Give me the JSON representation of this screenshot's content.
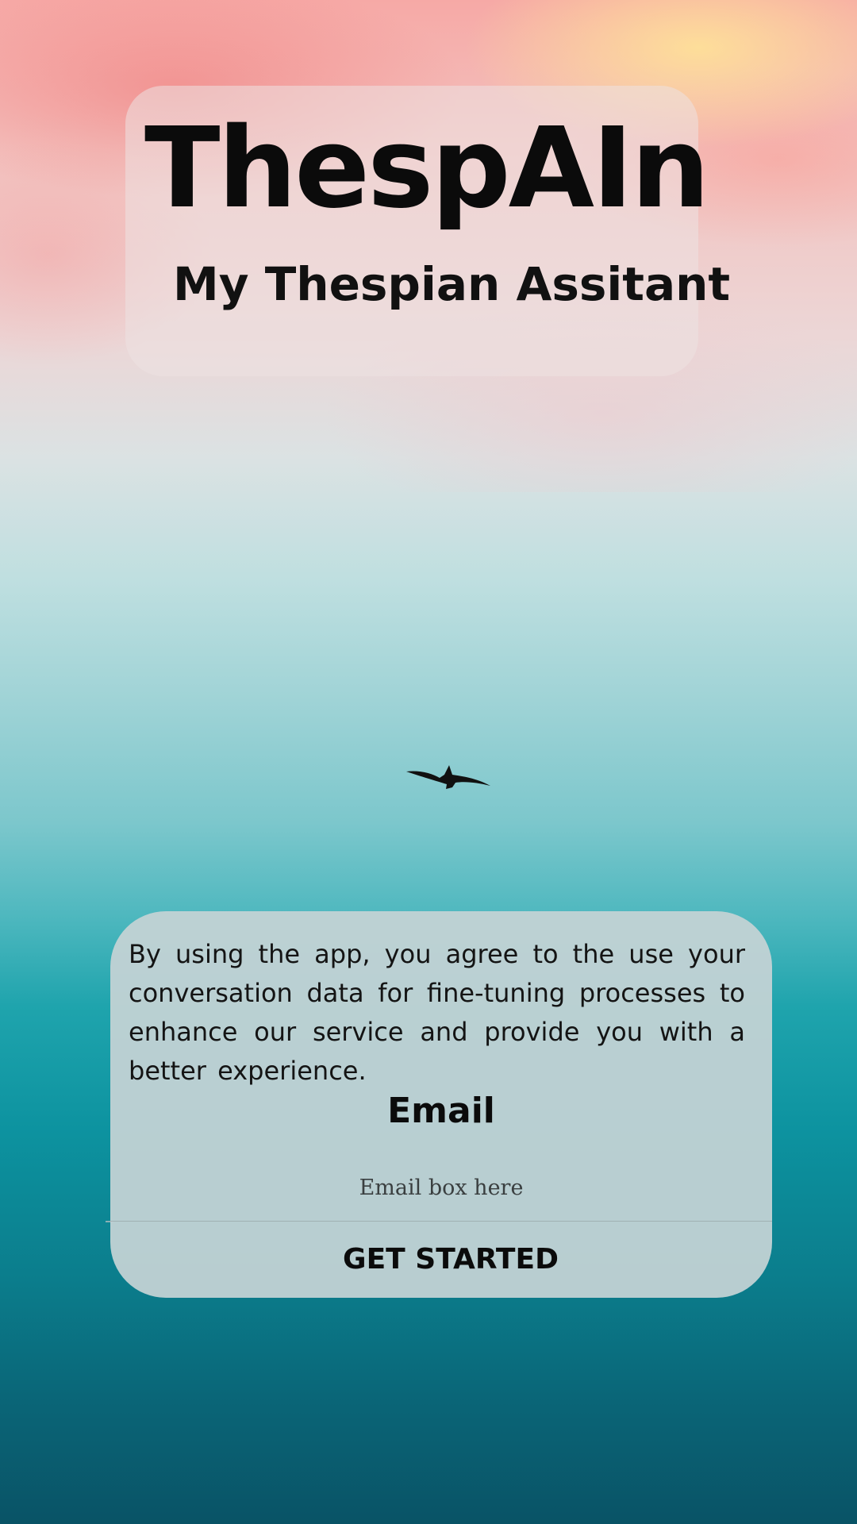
{
  "header": {
    "title": "ThespAIn",
    "subtitle": "My Thespian Assitant"
  },
  "background": {
    "icon": "bird-icon"
  },
  "form": {
    "consent_text": "By using the app, you agree to the  use your conversation data for fine-tuning processes to enhance our service and provide you with a better experience.",
    "email_label": "Email",
    "email_placeholder": "Email box here",
    "email_value": "",
    "submit_label": "GET STARTED"
  }
}
